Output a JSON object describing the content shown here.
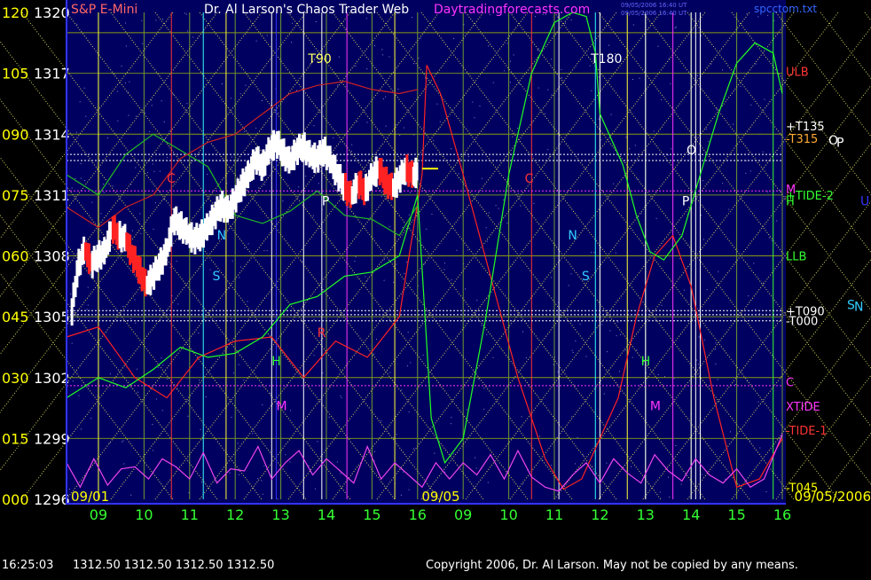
{
  "header": {
    "instrument": "S&P E-Mini",
    "title": "Dr. Al Larson's Chaos Trader Web",
    "site": "Daytradingforecasts.com",
    "stamp_line1": "09/05/2006 16:40 UT",
    "stamp_line2": "09/05/2006 16:40 UT",
    "file": "spcctom.txt"
  },
  "footer": {
    "time": "16:25:03",
    "ohlc": "1312.50  1312.50  1312.50  1312.50",
    "copyright": "Copyright 2006, Dr. Al Larson. May not be copied by any means."
  },
  "colors": {
    "background": "#000060",
    "axis_text": "#ffff00",
    "price_text": "#ffffff",
    "hour_text": "#33ff33",
    "frame": "#3333ff"
  },
  "chart_data": {
    "type": "line",
    "y_axis": {
      "min": 1296,
      "max": 1320,
      "ticks": [
        {
          "deg": "000",
          "price": "1296",
          "value": 1296
        },
        {
          "deg": "015",
          "price": "1299",
          "value": 1299
        },
        {
          "deg": "030",
          "price": "1302",
          "value": 1302
        },
        {
          "deg": "045",
          "price": "1305",
          "value": 1305
        },
        {
          "deg": "060",
          "price": "1308",
          "value": 1308
        },
        {
          "deg": "075",
          "price": "1311",
          "value": 1311
        },
        {
          "deg": "090",
          "price": "1314",
          "value": 1314
        },
        {
          "deg": "105",
          "price": "1317",
          "value": 1317
        },
        {
          "deg": "120",
          "price": "1320",
          "value": 1320
        }
      ]
    },
    "x_axis": {
      "min": 8.3,
      "max": 24.0,
      "hour_ticks": [
        {
          "label": "09",
          "t": 9
        },
        {
          "label": "10",
          "t": 10
        },
        {
          "label": "11",
          "t": 11
        },
        {
          "label": "12",
          "t": 12
        },
        {
          "label": "13",
          "t": 13
        },
        {
          "label": "14",
          "t": 14
        },
        {
          "label": "15",
          "t": 15
        },
        {
          "label": "16",
          "t": 16
        },
        {
          "label": "09",
          "t": 17
        },
        {
          "label": "10",
          "t": 18
        },
        {
          "label": "11",
          "t": 19
        },
        {
          "label": "12",
          "t": 20
        },
        {
          "label": "13",
          "t": 21
        },
        {
          "label": "14",
          "t": 22
        },
        {
          "label": "15",
          "t": 23
        },
        {
          "label": "16",
          "t": 24
        }
      ],
      "date_labels": [
        {
          "label": "09/01",
          "t": 8.3
        },
        {
          "label": "09/05",
          "t": 16.05
        },
        {
          "label": "09/05/2006",
          "t": 24.0
        }
      ]
    },
    "right_labels": [
      {
        "label": "ULB",
        "value": 1317.1,
        "color": "#ff3333"
      },
      {
        "label": "+T135",
        "value": 1314.4,
        "color": "#ffffff"
      },
      {
        "label": "-T315",
        "value": 1313.8,
        "color": "#ffaa33"
      },
      {
        "label": "M",
        "value": 1311.3,
        "color": "#ff33ff"
      },
      {
        "label": "+TIDE-2",
        "value": 1311.0,
        "color": "#33ff33"
      },
      {
        "label": "H",
        "value": 1310.7,
        "color": "#33ff33"
      },
      {
        "label": "LLB",
        "value": 1308.0,
        "color": "#33ff33"
      },
      {
        "label": "+T090",
        "value": 1305.3,
        "color": "#ffffff"
      },
      {
        "label": "-T000",
        "value": 1304.8,
        "color": "#ffffff"
      },
      {
        "label": "C",
        "value": 1301.8,
        "color": "#ff33ff"
      },
      {
        "label": "XTIDE",
        "value": 1300.6,
        "color": "#ff33ff"
      },
      {
        "label": "-TIDE-1",
        "value": 1299.4,
        "color": "#ff3333"
      },
      {
        "label": "-T045",
        "value": 1296.6,
        "color": "#ffff00"
      }
    ],
    "outside_labels": [
      {
        "label": "O",
        "value": 1313.7,
        "color": "#ffffff"
      },
      {
        "label": "P",
        "value": 1313.6,
        "color": "#ffffff"
      },
      {
        "label": "U",
        "value": 1310.7,
        "color": "#3333ff"
      },
      {
        "label": "S",
        "value": 1305.6,
        "color": "#33ccff"
      },
      {
        "label": "N",
        "value": 1305.5,
        "color": "#33ccff"
      }
    ],
    "chart_labels": [
      {
        "label": "T90",
        "t": 13.6,
        "value": 1317.5,
        "color": "#ffff66"
      },
      {
        "label": "T180",
        "t": 19.8,
        "value": 1317.5,
        "color": "#ffffff"
      },
      {
        "label": "C",
        "t": 10.5,
        "value": 1311.6,
        "color": "#ff3333"
      },
      {
        "label": "C",
        "t": 18.35,
        "value": 1311.6,
        "color": "#ff3333"
      },
      {
        "label": "N",
        "t": 11.6,
        "value": 1308.8,
        "color": "#33ccff"
      },
      {
        "label": "N",
        "t": 19.3,
        "value": 1308.8,
        "color": "#33ccff"
      },
      {
        "label": "S",
        "t": 11.5,
        "value": 1306.8,
        "color": "#33ccff"
      },
      {
        "label": "S",
        "t": 19.6,
        "value": 1306.8,
        "color": "#33ccff"
      },
      {
        "label": "P",
        "t": 13.9,
        "value": 1310.5,
        "color": "#ffffff"
      },
      {
        "label": "P",
        "t": 21.8,
        "value": 1310.5,
        "color": "#ffffff"
      },
      {
        "label": "O",
        "t": 21.9,
        "value": 1313.0,
        "color": "#ffffff"
      },
      {
        "label": "H",
        "t": 12.8,
        "value": 1302.6,
        "color": "#33ff33"
      },
      {
        "label": "H",
        "t": 20.9,
        "value": 1302.6,
        "color": "#33ff33"
      },
      {
        "label": "M",
        "t": 12.9,
        "value": 1300.4,
        "color": "#ff33ff"
      },
      {
        "label": "M",
        "t": 21.1,
        "value": 1300.4,
        "color": "#ff33ff"
      },
      {
        "label": "R",
        "t": 13.8,
        "value": 1304.0,
        "color": "#ff3333"
      }
    ],
    "grid_levels": [
      1299,
      1302,
      1305,
      1308,
      1311,
      1314,
      1317,
      1319
    ],
    "vertical_lines": [
      {
        "t": 9.0,
        "color": "#ffff33"
      },
      {
        "t": 10.6,
        "color": "#ff3333"
      },
      {
        "t": 11.3,
        "color": "#33ffff"
      },
      {
        "t": 11.8,
        "color": "#ffff33"
      },
      {
        "t": 12.8,
        "color": "#ffffff"
      },
      {
        "t": 12.9,
        "color": "#3333ff"
      },
      {
        "t": 13.5,
        "color": "#ffffff"
      },
      {
        "t": 13.9,
        "color": "#ffffff"
      },
      {
        "t": 14.45,
        "color": "#ff33ff"
      },
      {
        "t": 15.5,
        "color": "#ffff33"
      },
      {
        "t": 19.1,
        "color": "#ffffff"
      },
      {
        "t": 18.5,
        "color": "#ff3333"
      },
      {
        "t": 19.9,
        "color": "#33ffff"
      },
      {
        "t": 20.0,
        "color": "#ffffff"
      },
      {
        "t": 20.6,
        "color": "#ffff33"
      },
      {
        "t": 21.0,
        "color": "#ffffff"
      },
      {
        "t": 21.6,
        "color": "#ff33ff"
      },
      {
        "t": 22.0,
        "color": "#ffffff"
      },
      {
        "t": 22.1,
        "color": "#ffffff"
      },
      {
        "t": 22.2,
        "color": "#ffffff"
      },
      {
        "t": 23.8,
        "color": "#33ff33"
      }
    ],
    "horizontal_lines": [
      {
        "value": 1313.0,
        "color": "#ffffff"
      },
      {
        "value": 1312.7,
        "color": "#ffffff"
      },
      {
        "value": 1311.2,
        "color": "#ff33ff"
      },
      {
        "value": 1305.3,
        "color": "#ffffff"
      },
      {
        "value": 1305.1,
        "color": "#ffffff"
      },
      {
        "value": 1304.8,
        "color": "#ffffff"
      },
      {
        "value": 1301.6,
        "color": "#ff33ff"
      }
    ],
    "series": [
      {
        "kind": "price",
        "x": [
          8.4,
          8.55,
          8.7,
          8.85,
          9.0,
          9.15,
          9.3,
          9.45,
          9.6,
          9.75,
          9.9,
          10.05,
          10.2,
          10.35,
          10.5,
          10.65,
          10.8,
          10.95,
          11.1,
          11.25,
          11.4,
          11.55,
          11.7,
          11.85,
          12.0,
          12.15,
          12.3,
          12.45,
          12.6,
          12.75,
          12.9,
          13.05,
          13.2,
          13.35,
          13.5,
          13.65,
          13.8,
          13.95,
          14.1,
          14.25,
          14.4,
          14.55,
          14.7,
          14.85,
          15.0,
          15.15,
          15.3,
          15.45,
          15.6,
          15.75,
          15.9,
          16.0
        ],
        "y": [
          1305.0,
          1307.5,
          1308.3,
          1307.6,
          1308.0,
          1308.2,
          1309.4,
          1309.0,
          1308.8,
          1308.0,
          1307.3,
          1306.5,
          1307.0,
          1307.6,
          1308.2,
          1309.8,
          1309.5,
          1309.1,
          1308.8,
          1309.0,
          1309.4,
          1310.0,
          1310.5,
          1310.2,
          1310.8,
          1311.5,
          1312.0,
          1312.8,
          1312.4,
          1313.2,
          1313.6,
          1313.1,
          1312.6,
          1313.2,
          1313.4,
          1312.9,
          1312.8,
          1313.2,
          1312.6,
          1312.0,
          1311.4,
          1310.9,
          1311.6,
          1311.2,
          1311.9,
          1312.3,
          1311.7,
          1311.3,
          1311.8,
          1312.3,
          1311.9,
          1312.2
        ]
      },
      {
        "kind": "red-cycle",
        "x": [
          8.3,
          9.0,
          9.8,
          10.5,
          11.2,
          12.0,
          12.8,
          13.5,
          14.2,
          14.9,
          15.6,
          16.1,
          16.2,
          16.5,
          17.0,
          17.6,
          18.2,
          18.8,
          19.2,
          19.6,
          20.0,
          20.4,
          20.8,
          21.2,
          21.6,
          22.0,
          22.5,
          23.0,
          23.5,
          24.0
        ],
        "y": [
          1304.0,
          1304.5,
          1302.0,
          1301.0,
          1303.0,
          1303.8,
          1304.0,
          1302.0,
          1303.8,
          1303.0,
          1305.0,
          1312.0,
          1317.4,
          1316.0,
          1312.0,
          1307.0,
          1302.0,
          1298.0,
          1296.5,
          1297.0,
          1299.0,
          1301.0,
          1305.0,
          1308.0,
          1309.0,
          1306.5,
          1301.0,
          1296.6,
          1297.0,
          1299.0
        ]
      },
      {
        "kind": "green-cycle",
        "x": [
          8.3,
          9.0,
          9.6,
          10.2,
          10.8,
          11.4,
          12.0,
          12.6,
          13.2,
          13.8,
          14.4,
          15.0,
          15.6,
          16.0,
          16.3,
          16.6,
          17.0,
          17.5,
          18.0,
          18.5,
          19.0,
          19.4,
          19.7,
          19.9,
          20.0,
          20.2,
          20.5,
          20.8,
          21.1,
          21.4,
          21.8,
          22.2,
          22.6,
          23.0,
          23.4,
          23.8,
          24.0
        ],
        "y": [
          1301.0,
          1302.0,
          1301.5,
          1302.4,
          1303.5,
          1303.0,
          1303.2,
          1304.0,
          1305.6,
          1306.0,
          1307.0,
          1307.2,
          1308.0,
          1311.0,
          1300.0,
          1297.8,
          1299.0,
          1305.0,
          1312.0,
          1317.0,
          1319.5,
          1320.0,
          1319.8,
          1318.0,
          1315.0,
          1314.0,
          1312.5,
          1310.0,
          1308.2,
          1307.8,
          1309.0,
          1312.0,
          1315.0,
          1317.5,
          1318.5,
          1318.0,
          1316.0
        ]
      },
      {
        "kind": "xtide",
        "x": [
          8.3,
          8.6,
          8.9,
          9.2,
          9.5,
          9.8,
          10.1,
          10.4,
          10.7,
          11.0,
          11.3,
          11.6,
          11.9,
          12.2,
          12.5,
          12.8,
          13.1,
          13.4,
          13.7,
          14.0,
          14.3,
          14.6,
          14.9,
          15.2,
          15.5,
          15.8,
          16.1,
          16.4,
          16.7,
          17.0,
          17.3,
          17.6,
          17.9,
          18.2,
          18.5,
          18.8,
          19.1,
          19.4,
          19.7,
          20.0,
          20.3,
          20.6,
          20.9,
          21.2,
          21.5,
          21.8,
          22.1,
          22.4,
          22.7,
          23.0,
          23.3,
          23.6,
          24.0
        ],
        "y": [
          1297.8,
          1296.6,
          1298.0,
          1296.7,
          1297.5,
          1297.6,
          1297.0,
          1298.0,
          1297.6,
          1297.0,
          1298.3,
          1296.8,
          1297.5,
          1297.4,
          1298.6,
          1297.0,
          1297.8,
          1298.4,
          1297.2,
          1298.0,
          1297.4,
          1296.8,
          1298.6,
          1297.0,
          1297.8,
          1297.2,
          1296.6,
          1297.8,
          1297.0,
          1297.8,
          1297.2,
          1298.2,
          1297.0,
          1298.4,
          1297.1,
          1296.6,
          1296.4,
          1297.2,
          1297.8,
          1296.8,
          1298.0,
          1297.3,
          1296.8,
          1298.2,
          1297.4,
          1296.9,
          1298.0,
          1297.2,
          1296.8,
          1297.5,
          1296.6,
          1297.0,
          1299.2
        ]
      },
      {
        "kind": "green-band",
        "x": [
          8.3,
          9.0,
          9.6,
          10.2,
          10.8,
          11.4,
          12.0,
          12.6,
          13.2,
          13.8,
          14.4,
          15.0,
          15.6,
          16.0
        ],
        "y": [
          1312.0,
          1311.0,
          1313.0,
          1314.0,
          1313.2,
          1312.4,
          1310.0,
          1309.6,
          1310.2,
          1311.2,
          1310.0,
          1309.8,
          1309.0,
          1310.5
        ]
      },
      {
        "kind": "red-band",
        "x": [
          8.3,
          9.0,
          9.6,
          10.2,
          10.8,
          11.4,
          12.0,
          12.6,
          13.2,
          13.8,
          14.4,
          15.0,
          15.6,
          16.0
        ],
        "y": [
          1310.4,
          1309.4,
          1310.4,
          1311.0,
          1312.8,
          1313.6,
          1314.0,
          1315.0,
          1316.0,
          1316.4,
          1316.6,
          1316.2,
          1316.0,
          1316.2
        ]
      }
    ]
  }
}
